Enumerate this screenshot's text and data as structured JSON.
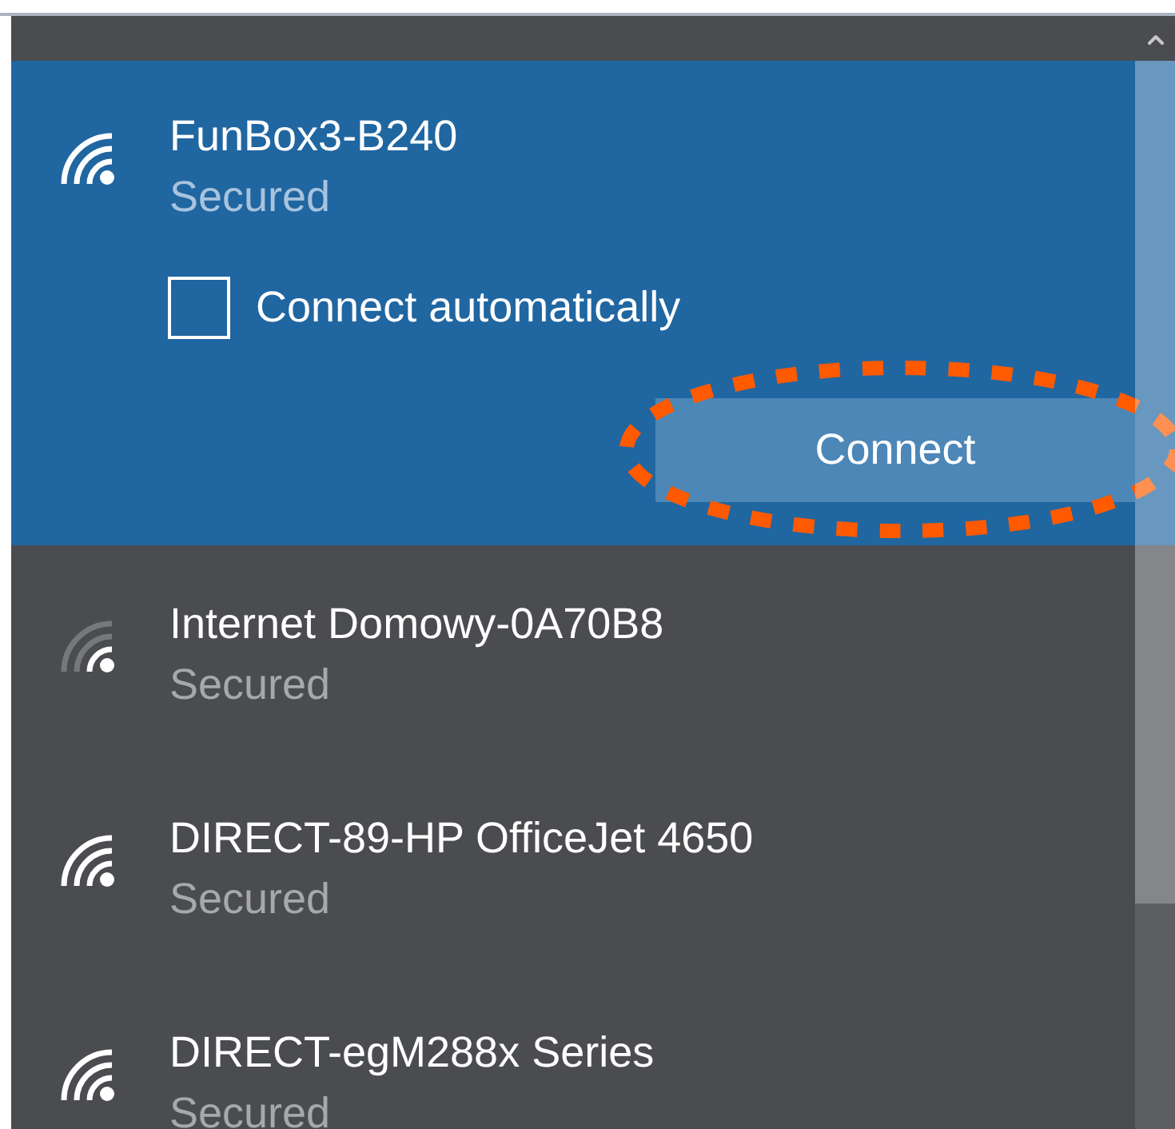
{
  "networks": [
    {
      "name": "FunBox3-B240",
      "status": "Secured",
      "selected": true,
      "weak_signal": false,
      "auto_connect": {
        "label": "Connect automatically",
        "checked": false
      },
      "connect_button": "Connect"
    },
    {
      "name": "Internet Domowy-0A70B8",
      "status": "Secured",
      "selected": false,
      "weak_signal": true
    },
    {
      "name": "DIRECT-89-HP OfficeJet 4650",
      "status": "Secured",
      "selected": false,
      "weak_signal": false
    },
    {
      "name": "DIRECT-egM288x Series",
      "status": "Secured",
      "selected": false,
      "weak_signal": false
    }
  ]
}
